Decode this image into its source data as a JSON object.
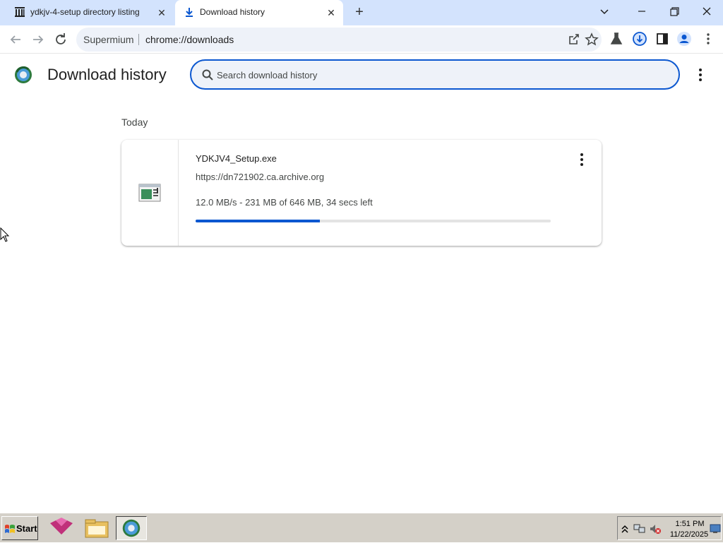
{
  "browser": {
    "tabs": [
      {
        "title": "ydkjv-4-setup directory listing",
        "icon": "archive-library-icon"
      },
      {
        "title": "Download history",
        "icon": "download-arrow-icon"
      }
    ],
    "new_tab_label": "+",
    "omnibox": {
      "brand": "Supermium",
      "url": "chrome://downloads"
    }
  },
  "page": {
    "title": "Download history",
    "search_placeholder": "Search download history"
  },
  "downloads": {
    "section_label": "Today",
    "items": [
      {
        "file_name": "YDKJV4_Setup.exe",
        "url": "https://dn721902.ca.archive.org",
        "status": "12.0 MB/s - 231 MB of 646 MB, 34 secs left",
        "progress_fraction": 0.35
      }
    ]
  },
  "taskbar": {
    "start_label": "Start",
    "time": "1:51 PM",
    "date": "11/22/2025"
  },
  "colors": {
    "accent": "#0b57d0",
    "tabstrip": "#d3e3fd",
    "taskbar": "#d4d0c8"
  }
}
